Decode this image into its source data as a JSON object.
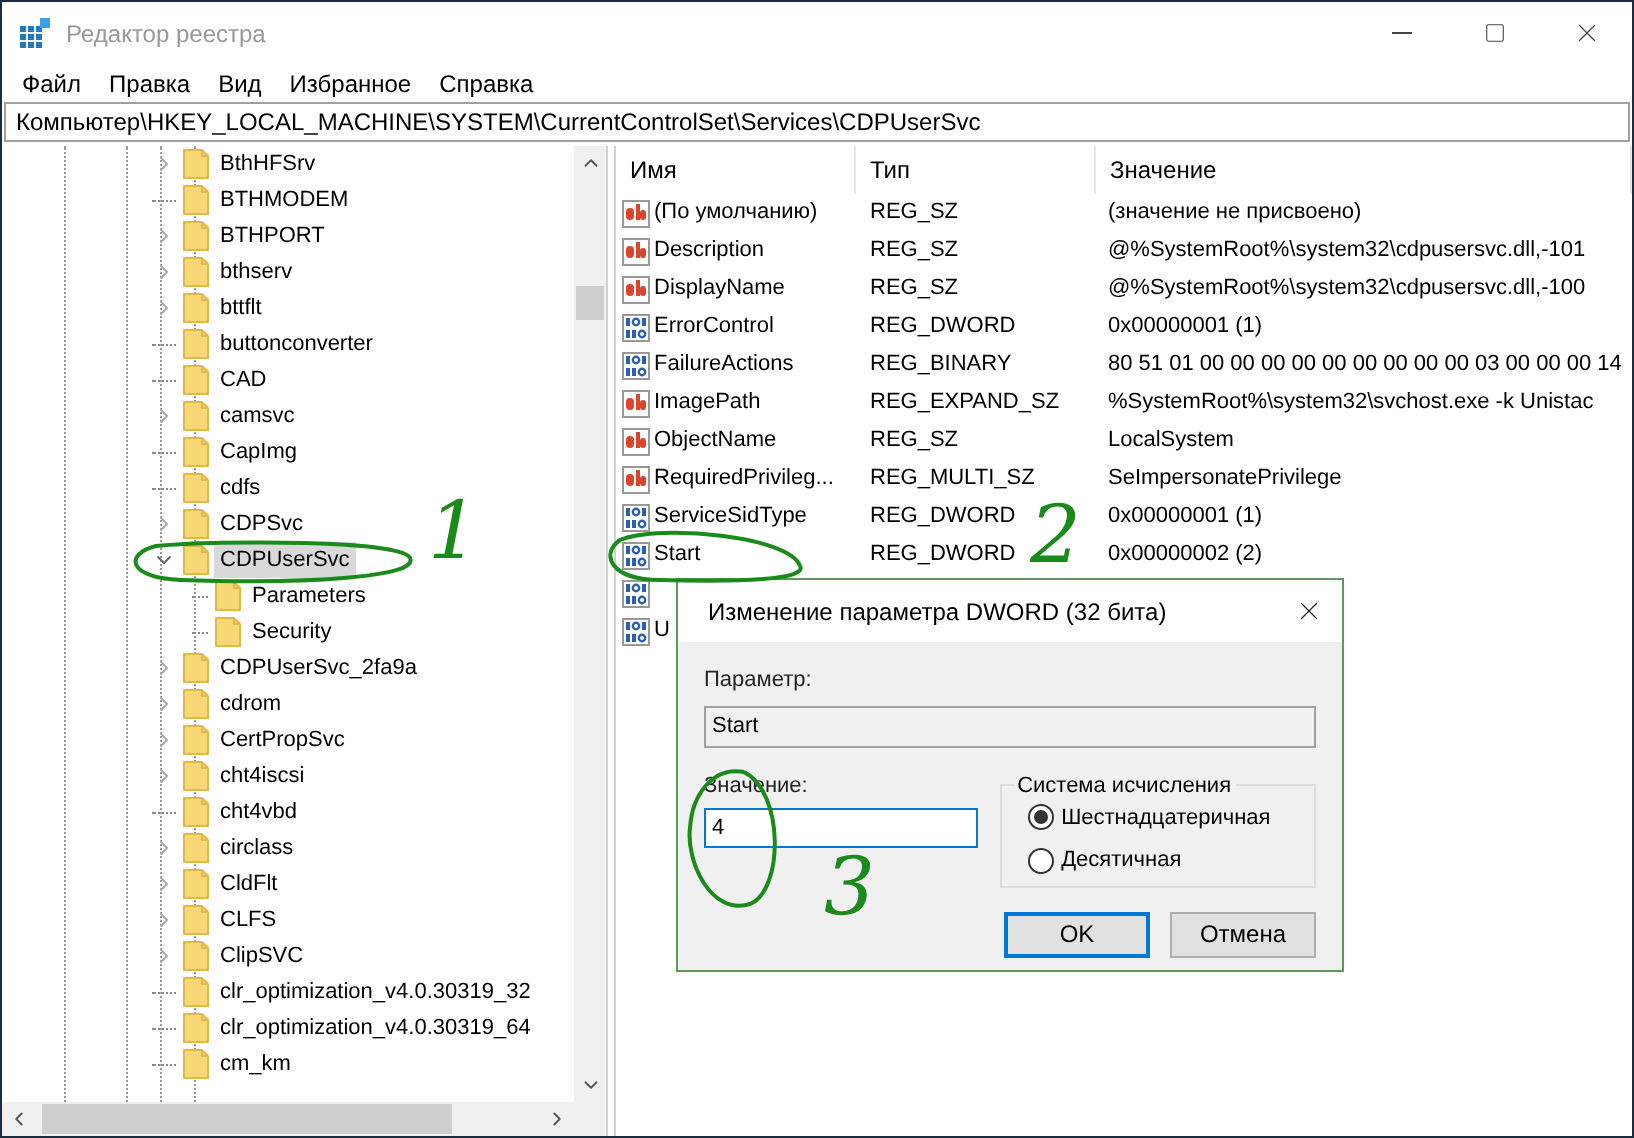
{
  "window": {
    "title": "Редактор реестра"
  },
  "menu": [
    "Файл",
    "Правка",
    "Вид",
    "Избранное",
    "Справка"
  ],
  "address": "Компьютер\\HKEY_LOCAL_MACHINE\\SYSTEM\\CurrentControlSet\\Services\\CDPUserSvc",
  "tree": [
    {
      "label": "BthHFSrv",
      "kind": "branch",
      "expanded": false,
      "selected": false
    },
    {
      "label": "BTHMODEM",
      "kind": "leaf",
      "selected": false
    },
    {
      "label": "BTHPORT",
      "kind": "branch",
      "expanded": false,
      "selected": false
    },
    {
      "label": "bthserv",
      "kind": "branch",
      "expanded": false,
      "selected": false
    },
    {
      "label": "bttflt",
      "kind": "branch",
      "expanded": false,
      "selected": false
    },
    {
      "label": "buttonconverter",
      "kind": "leaf",
      "selected": false
    },
    {
      "label": "CAD",
      "kind": "leaf",
      "selected": false
    },
    {
      "label": "camsvc",
      "kind": "branch",
      "expanded": false,
      "selected": false
    },
    {
      "label": "CapImg",
      "kind": "leaf",
      "selected": false
    },
    {
      "label": "cdfs",
      "kind": "leaf",
      "selected": false
    },
    {
      "label": "CDPSvc",
      "kind": "branch",
      "expanded": false,
      "selected": false
    },
    {
      "label": "CDPUserSvc",
      "kind": "branch",
      "expanded": true,
      "selected": true,
      "children": [
        {
          "label": "Parameters",
          "kind": "leaf",
          "selected": false
        },
        {
          "label": "Security",
          "kind": "leaf",
          "selected": false
        }
      ]
    },
    {
      "label": "CDPUserSvc_2fa9a",
      "kind": "branch",
      "expanded": false,
      "selected": false
    },
    {
      "label": "cdrom",
      "kind": "branch",
      "expanded": false,
      "selected": false
    },
    {
      "label": "CertPropSvc",
      "kind": "branch",
      "expanded": false,
      "selected": false
    },
    {
      "label": "cht4iscsi",
      "kind": "branch",
      "expanded": false,
      "selected": false
    },
    {
      "label": "cht4vbd",
      "kind": "leaf",
      "selected": false
    },
    {
      "label": "circlass",
      "kind": "branch",
      "expanded": false,
      "selected": false
    },
    {
      "label": "CldFlt",
      "kind": "branch",
      "expanded": false,
      "selected": false
    },
    {
      "label": "CLFS",
      "kind": "branch",
      "expanded": false,
      "selected": false
    },
    {
      "label": "ClipSVC",
      "kind": "branch",
      "expanded": false,
      "selected": false
    },
    {
      "label": "clr_optimization_v4.0.30319_32",
      "kind": "leaf",
      "selected": false
    },
    {
      "label": "clr_optimization_v4.0.30319_64",
      "kind": "leaf",
      "selected": false
    },
    {
      "label": "cm_km",
      "kind": "leaf",
      "selected": false
    }
  ],
  "table": {
    "columns": [
      "Имя",
      "Тип",
      "Значение"
    ],
    "rows": [
      {
        "kind": "string",
        "name": "(По умолчанию)",
        "type": "REG_SZ",
        "value": "(значение не присвоено)"
      },
      {
        "kind": "string",
        "name": "Description",
        "type": "REG_SZ",
        "value": "@%SystemRoot%\\system32\\cdpusersvc.dll,-101"
      },
      {
        "kind": "string",
        "name": "DisplayName",
        "type": "REG_SZ",
        "value": "@%SystemRoot%\\system32\\cdpusersvc.dll,-100"
      },
      {
        "kind": "binary",
        "name": "ErrorControl",
        "type": "REG_DWORD",
        "value": "0x00000001 (1)"
      },
      {
        "kind": "binary",
        "name": "FailureActions",
        "type": "REG_BINARY",
        "value": "80 51 01 00 00 00 00 00 00 00 00 00 03 00 00 00 14"
      },
      {
        "kind": "string",
        "name": "ImagePath",
        "type": "REG_EXPAND_SZ",
        "value": "%SystemRoot%\\system32\\svchost.exe -k Unistac"
      },
      {
        "kind": "string",
        "name": "ObjectName",
        "type": "REG_SZ",
        "value": "LocalSystem"
      },
      {
        "kind": "string",
        "name": "RequiredPrivileg...",
        "type": "REG_MULTI_SZ",
        "value": "SeImpersonatePrivilege"
      },
      {
        "kind": "binary",
        "name": "ServiceSidType",
        "type": "REG_DWORD",
        "value": "0x00000001 (1)"
      },
      {
        "kind": "binary",
        "name": "Start",
        "type": "REG_DWORD",
        "value": "0x00000002 (2)"
      },
      {
        "kind": "binary"
      },
      {
        "kind": "binary",
        "name": "U"
      }
    ]
  },
  "dialog": {
    "title": "Изменение параметра DWORD (32 бита)",
    "param_label": "Параметр:",
    "param_value": "Start",
    "value_label": "Значение:",
    "value": "4",
    "base_group": "Система исчисления",
    "bases": [
      {
        "label": "Шестнадцатеричная",
        "selected": true
      },
      {
        "label": "Десятичная",
        "selected": false
      }
    ],
    "ok": "OK",
    "cancel": "Отмена"
  },
  "annotations": [
    {
      "label": "1"
    },
    {
      "label": "2"
    },
    {
      "label": "3"
    }
  ]
}
